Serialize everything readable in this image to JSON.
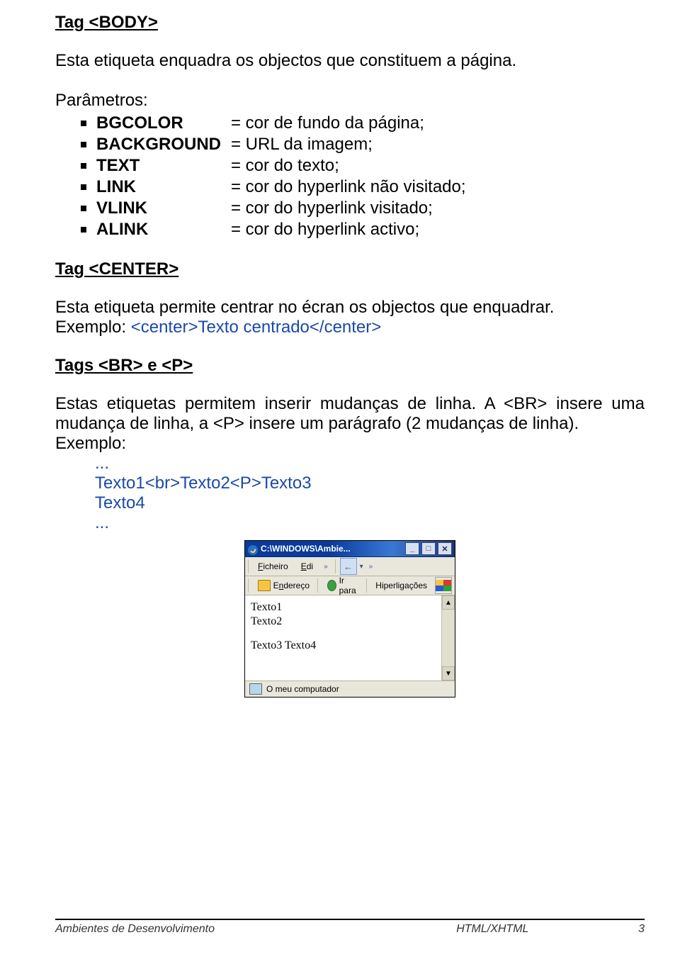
{
  "sections": {
    "body_tag": {
      "heading": "Tag <BODY>",
      "text": "Esta etiqueta enquadra os objectos que constituem a página."
    },
    "params": {
      "label": "Parâmetros:",
      "items": [
        {
          "key": "BGCOLOR",
          "val": "= cor de fundo da página;"
        },
        {
          "key": "BACKGROUND",
          "val": "= URL da imagem;"
        },
        {
          "key": "TEXT",
          "val": "= cor do texto;"
        },
        {
          "key": "LINK",
          "val": "= cor do hyperlink não visitado;"
        },
        {
          "key": "VLINK",
          "val": "= cor do hyperlink visitado;"
        },
        {
          "key": "ALINK",
          "val": "= cor do hyperlink activo;"
        }
      ]
    },
    "center_tag": {
      "heading": "Tag <CENTER>",
      "text": "Esta etiqueta permite centrar no écran os objectos que enquadrar.",
      "example_label": "Exemplo: ",
      "example_code": "<center>Texto centrado</center>"
    },
    "brp_tags": {
      "heading": "Tags <BR> e <P>",
      "text": "Estas etiquetas permitem inserir mudanças de linha. A <BR> insere uma mudança de linha, a <P> insere um parágrafo (2 mudanças de linha).",
      "example_label": "Exemplo:",
      "ellipsis": "...",
      "code_lines": [
        "Texto1<br>Texto2<P>Texto3",
        "Texto4"
      ]
    }
  },
  "mini_browser": {
    "title": "C:\\WINDOWS\\Ambie...",
    "menu": {
      "ficheiro": "Ficheiro",
      "edi": "Edi"
    },
    "toolbar": {
      "endereco": "Endereço",
      "irpara": "Ir para",
      "hiperlig": "Hiperligações"
    },
    "content": {
      "l1": "Texto1",
      "l2": "Texto2",
      "l3": "Texto3 Texto4"
    },
    "status": "O meu computador",
    "buttons": {
      "min": "_",
      "max": "□",
      "close": "✕"
    },
    "chev": "»"
  },
  "footer": {
    "left": "Ambientes de Desenvolvimento",
    "mid": "HTML/XHTML",
    "right": "3"
  }
}
